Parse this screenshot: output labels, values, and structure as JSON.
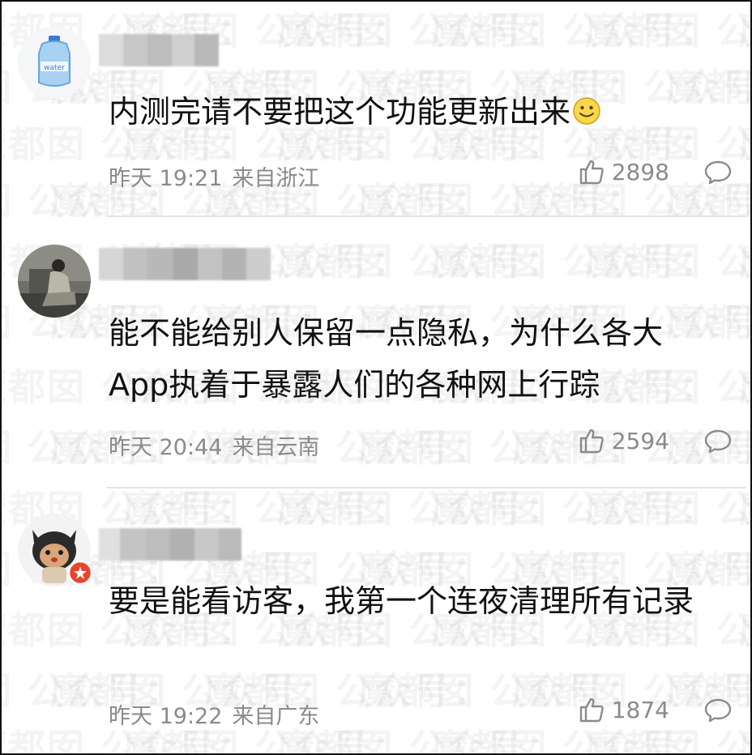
{
  "watermark": "魔都囡 公众号：",
  "comments": [
    {
      "text": "内测完请不要把这个功能更新出来",
      "emoji": "smile-icon",
      "date": "昨天 19:21",
      "location": "来自浙江",
      "likes": "2898"
    },
    {
      "text": "能不能给别人保留一点隐私，为什么各大App执着于暴露人们的各种网上行踪",
      "date": "昨天 20:44",
      "location": "来自云南",
      "likes": "2594"
    },
    {
      "text": "要是能看访客，我第一个连夜清理所有记录",
      "date": "昨天 19:22",
      "location": "来自广东",
      "likes": "1874"
    }
  ],
  "colors": {
    "meta": "#8a8a8a",
    "text": "#111111",
    "badge": "#e8452c"
  }
}
